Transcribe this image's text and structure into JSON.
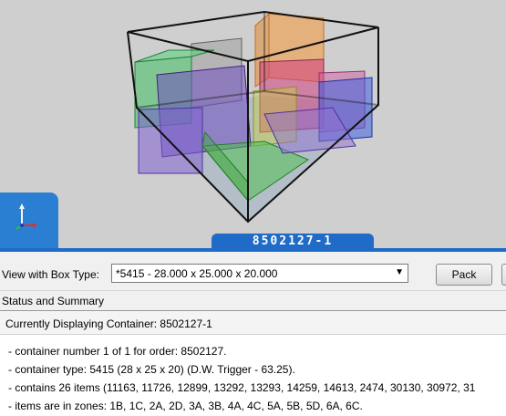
{
  "viewer": {
    "container_tab_label": "8502127-1",
    "axis_icon": "xyz-axis-icon"
  },
  "toolbar": {
    "view_label": "View with Box Type:",
    "box_type_value": "*5415 - 28.000 x 25.000 x 20.000",
    "dropdown_icon": "▼",
    "pack_label": "Pack"
  },
  "status": {
    "section_title": "Status and Summary",
    "header": "Currently Displaying Container: 8502127-1",
    "lines": [
      "- container number 1 of 1 for order: 8502127.",
      "- container type: 5415 (28 x 25 x 20) (D.W. Trigger - 63.25).",
      "- contains 26 items (11163, 11726, 12899, 13292, 13293, 14259, 14613, 2474, 30130, 30972, 31",
      "- items are in zones: 1B, 1C, 2A, 2D, 3A, 3B, 4A, 4C, 5A, 5B, 5D, 6A, 6C."
    ]
  },
  "colors": {
    "accent_blue": "#1f6bc7",
    "viewport_bg": "#cfcfcf",
    "box_orange": "#f0a050",
    "box_green": "#40c060",
    "box_purple": "#8060d0",
    "box_magenta": "#d04080",
    "box_blue": "#4060e0",
    "box_yellow": "#c8d040"
  }
}
